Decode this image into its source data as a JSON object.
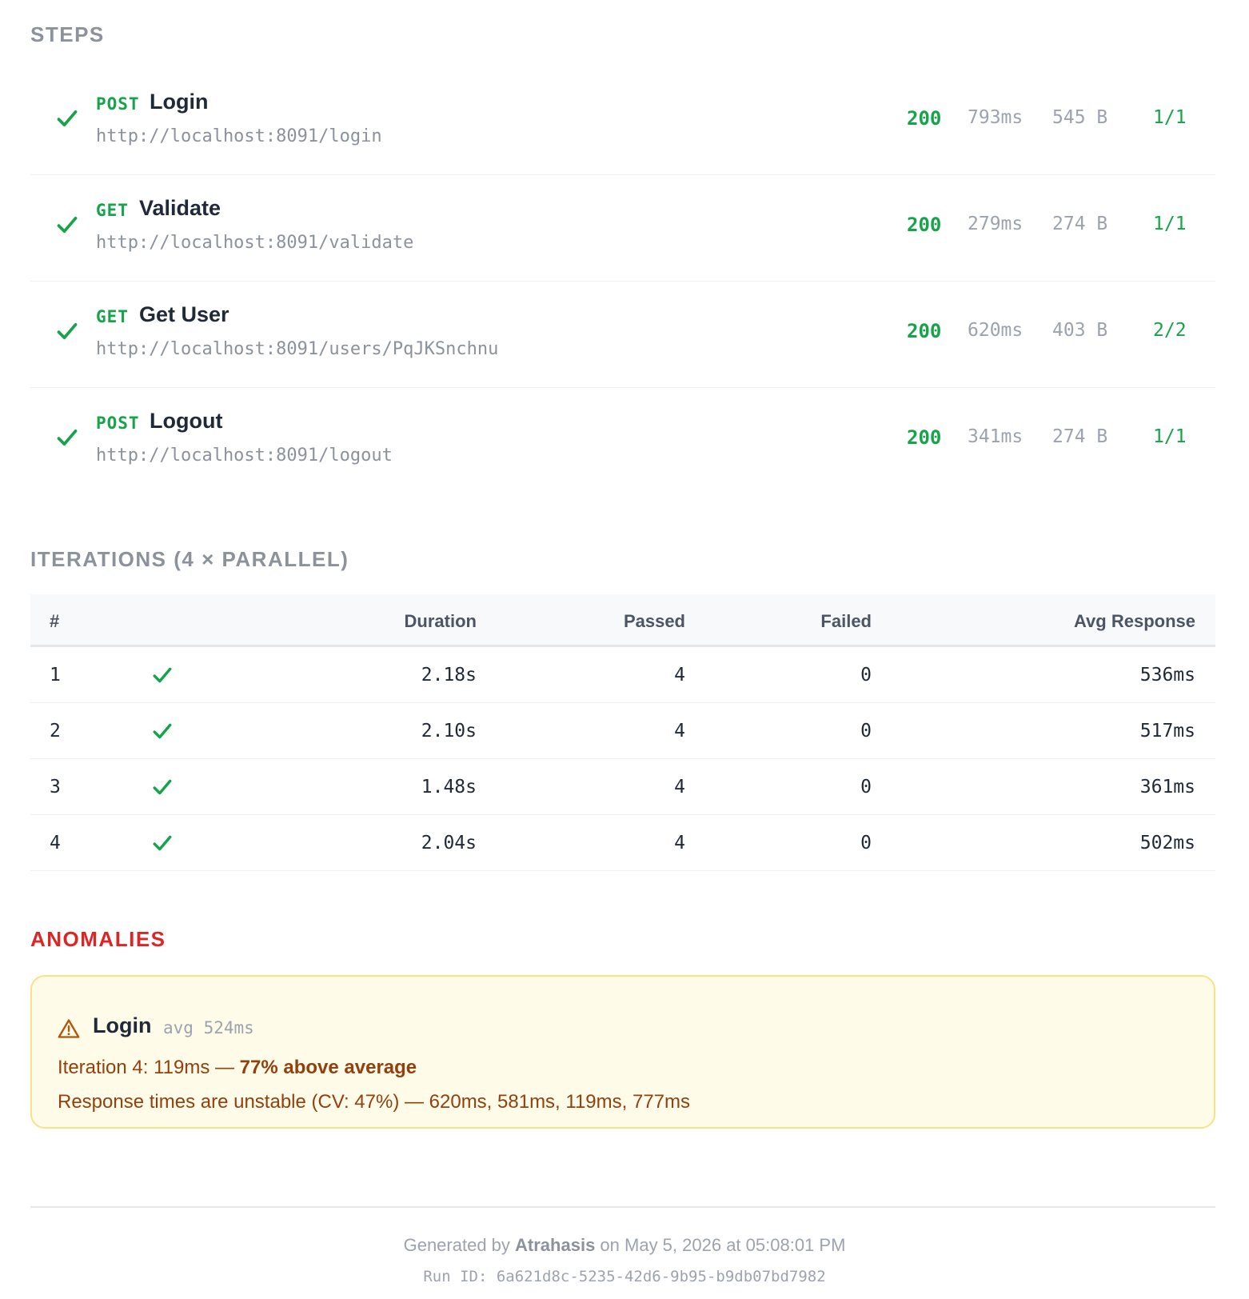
{
  "steps_section": {
    "title": "STEPS",
    "items": [
      {
        "method": "POST",
        "name": "Login",
        "url": "http://localhost:8091/login",
        "status": "200",
        "time": "793ms",
        "size": "545 B",
        "ratio": "1/1"
      },
      {
        "method": "GET",
        "name": "Validate",
        "url": "http://localhost:8091/validate",
        "status": "200",
        "time": "279ms",
        "size": "274 B",
        "ratio": "1/1"
      },
      {
        "method": "GET",
        "name": "Get User",
        "url": "http://localhost:8091/users/PqJKSnchnu",
        "status": "200",
        "time": "620ms",
        "size": "403 B",
        "ratio": "2/2"
      },
      {
        "method": "POST",
        "name": "Logout",
        "url": "http://localhost:8091/logout",
        "status": "200",
        "time": "341ms",
        "size": "274 B",
        "ratio": "1/1"
      }
    ]
  },
  "iterations_section": {
    "title": "ITERATIONS (4 × PARALLEL)",
    "headers": {
      "num": "#",
      "duration": "Duration",
      "passed": "Passed",
      "failed": "Failed",
      "avg": "Avg Response"
    },
    "rows": [
      {
        "num": "1",
        "duration": "2.18s",
        "passed": "4",
        "failed": "0",
        "avg": "536ms"
      },
      {
        "num": "2",
        "duration": "2.10s",
        "passed": "4",
        "failed": "0",
        "avg": "517ms"
      },
      {
        "num": "3",
        "duration": "1.48s",
        "passed": "4",
        "failed": "0",
        "avg": "361ms"
      },
      {
        "num": "4",
        "duration": "2.04s",
        "passed": "4",
        "failed": "0",
        "avg": "502ms"
      }
    ]
  },
  "anomalies_section": {
    "title": "ANOMALIES",
    "card": {
      "name": "Login",
      "avg": "avg 524ms",
      "line1_prefix": "Iteration 4: 119ms — ",
      "line1_emphasis": "77% above average",
      "line2": "Response times are unstable (CV: 47%) — 620ms, 581ms, 119ms, 777ms"
    }
  },
  "footer": {
    "generated_prefix": "Generated by ",
    "generator": "Atrahasis",
    "generated_suffix": " on May 5, 2026 at 05:08:01 PM",
    "run_id": "Run ID: 6a621d8c-5235-42d6-9b95-b9db07bd7982"
  },
  "colors": {
    "success": "#16a34a",
    "danger": "#dc2626",
    "warning_text": "#92400e",
    "warning_bg": "#fefbe8",
    "muted": "#9ca3af"
  }
}
